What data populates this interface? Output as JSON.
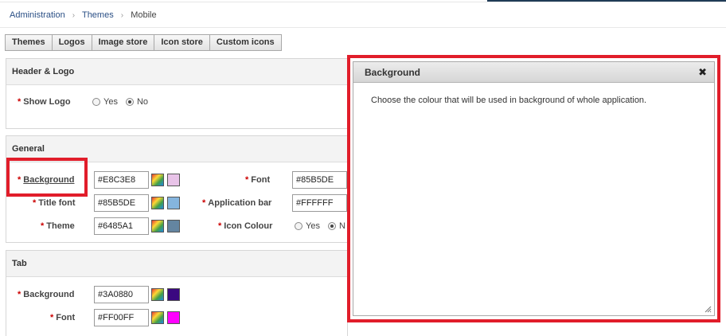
{
  "breadcrumb": {
    "item1": "Administration",
    "item2": "Themes",
    "item3": "Mobile",
    "separator": "›"
  },
  "tabs": [
    {
      "label": "Themes"
    },
    {
      "label": "Logos"
    },
    {
      "label": "Image store"
    },
    {
      "label": "Icon store"
    },
    {
      "label": "Custom icons"
    }
  ],
  "header_logo": {
    "title": "Header & Logo",
    "show_logo": {
      "label": "Show Logo",
      "yes": "Yes",
      "no": "No",
      "selected": "No"
    }
  },
  "general": {
    "title": "General",
    "background": {
      "label": "Background",
      "value": "#E8C3E8",
      "color": "#E8C3E8"
    },
    "title_font": {
      "label": "Title font",
      "value": "#85B5DE",
      "color": "#85B5DE"
    },
    "theme": {
      "label": "Theme",
      "value": "#6485A1",
      "color": "#6485A1"
    },
    "font": {
      "label": "Font",
      "value": "#85B5DE"
    },
    "application_bar": {
      "label": "Application bar",
      "value": "#FFFFFF"
    },
    "icon_colour": {
      "label": "Icon Colour",
      "yes": "Yes",
      "no_partial": "N",
      "selected": "No"
    }
  },
  "tab_section": {
    "title": "Tab",
    "background": {
      "label": "Background",
      "value": "#3A0880",
      "color": "#3A0880"
    },
    "font": {
      "label": "Font",
      "value": "#FF00FF",
      "color": "#FF00FF"
    }
  },
  "dialog": {
    "title": "Background",
    "close": "✖",
    "body": "Choose the colour that will be used in background of whole application."
  },
  "colors": {
    "required_star": "#cc0000",
    "highlight": "#e11d2a",
    "link": "#2a4f85"
  }
}
